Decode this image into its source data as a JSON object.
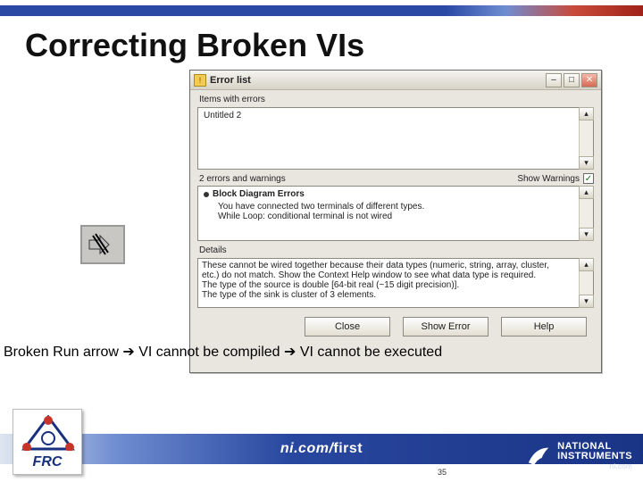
{
  "slide": {
    "title": "Correcting Broken VIs",
    "caption_prefix": "Broken Run arrow ",
    "caption_mid": " VI cannot be compiled ",
    "caption_end": " VI cannot be executed",
    "arrow_glyph": "➔",
    "page_number": "35"
  },
  "broken_icon": {
    "name": "broken-run-arrow-icon"
  },
  "window": {
    "title": "Error list",
    "buttons": {
      "min": "–",
      "max": "□",
      "close": "✕"
    },
    "items_label": "Items with errors",
    "items": [
      "Untitled 2"
    ],
    "warn_count_label": "2 errors and warnings",
    "show_warn_label": "Show Warnings",
    "show_warn_checked": "✓",
    "block_heading": "Block Diagram Errors",
    "warn_lines": [
      "You have connected two terminals of different types.",
      "While Loop: conditional terminal is not wired"
    ],
    "details_label": "Details",
    "details_lines": [
      "These cannot be wired together because their data types (numeric, string, array, cluster,",
      "etc.) do not match. Show the Context Help window to see what data type is required.",
      "The type of the source is double [64-bit real (~15 digit precision)].",
      "The type of the sink is cluster of 3 elements."
    ],
    "btn_close": "Close",
    "btn_show_error": "Show Error",
    "btn_help": "Help"
  },
  "footer": {
    "url_left": "ni.com/",
    "url_right": "first",
    "ni_line1": "NATIONAL",
    "ni_line2": "INSTRUMENTS",
    "ni_line3": "ni.com",
    "frc_label": "FRC"
  }
}
